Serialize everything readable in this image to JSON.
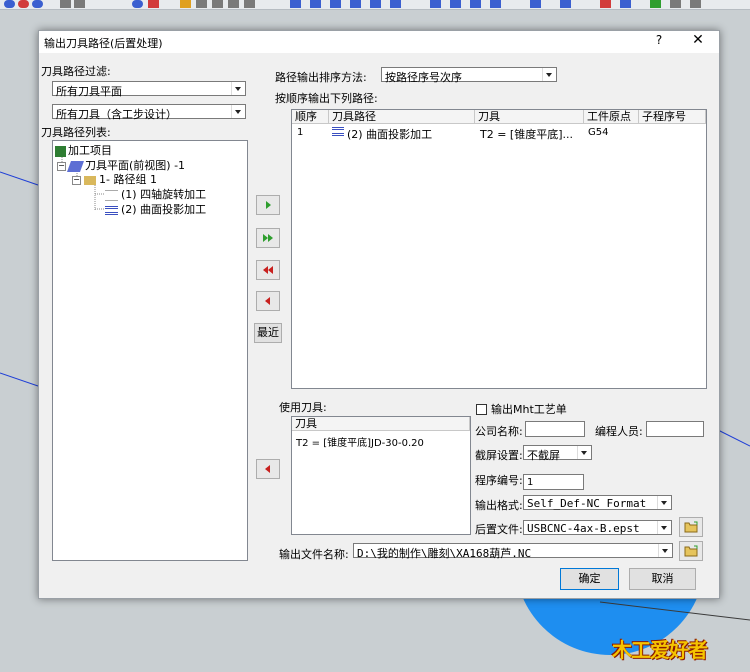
{
  "dialog": {
    "title": "输出刀具路径(后置处理)",
    "help": "?",
    "close": "✕"
  },
  "left": {
    "filter_label": "刀具路径过滤:",
    "plane_filter": "所有刀具平面",
    "tool_filter": "所有刀具（含工步设计）",
    "list_label": "刀具路径列表:",
    "tree": [
      {
        "label": "加工项目"
      },
      {
        "label": "刀具平面(前视图) -1"
      },
      {
        "label": "1- 路径组 1"
      },
      {
        "label": "(1) 四轴旋转加工"
      },
      {
        "label": "(2) 曲面投影加工"
      }
    ]
  },
  "right": {
    "sort_label": "路径输出排序方法:",
    "sort_value": "按路径序号次序",
    "output_label": "按顺序输出下列路径:",
    "columns": [
      "顺序",
      "刀具路径",
      "刀具",
      "工件原点",
      "子程序号"
    ],
    "rows": [
      {
        "order": "1",
        "path": "(2) 曲面投影加工",
        "tool": "T2 = [锥度平底]...",
        "origin": "G54",
        "sub": ""
      }
    ],
    "recent_button": "最近"
  },
  "tools": {
    "label": "使用刀具:",
    "column": "刀具",
    "items": [
      "T2 = [锥度平底]JD-30-0.20"
    ]
  },
  "options": {
    "mht_label": "输出Mht工艺单",
    "company_label": "公司名称:",
    "company_value": "",
    "programmer_label": "编程人员:",
    "programmer_value": "",
    "split_label": "截屏设置:",
    "split_value": "不截屏",
    "program_no_label": "程序编号:",
    "program_no_value": "1",
    "format_label": "输出格式:",
    "format_value": "Self_Def-NC Format",
    "post_label": "后置文件:",
    "post_value": "USBCNC-4ax-B.epst",
    "file_label": "输出文件名称:",
    "file_value": "D:\\我的制作\\雕刻\\XA168葫芦.NC"
  },
  "buttons": {
    "ok": "确定",
    "cancel": "取消"
  },
  "watermark": "木工爱好者",
  "colors": {
    "accent_green": "#2e9e2e",
    "accent_red": "#c8201e",
    "disc_blue": "#1e8ef0",
    "line_blue": "#1f3fd6"
  }
}
